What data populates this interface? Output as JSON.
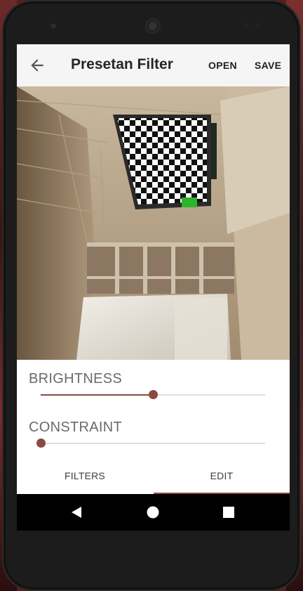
{
  "app_bar": {
    "back_icon": "arrow-back-icon",
    "title": "Presetan Filter",
    "open_label": "OPEN",
    "save_label": "SAVE"
  },
  "image": {
    "description_icon": "photo-preview",
    "accent": "#2bb52b"
  },
  "sliders": [
    {
      "label": "BRIGHTNESS",
      "value": 0.5
    },
    {
      "label": "CONSTRAINT",
      "value": 0.0
    }
  ],
  "tabs": [
    {
      "label": "FILTERS",
      "selected": false
    },
    {
      "label": "EDIT",
      "selected": true
    }
  ],
  "nav_bar": {
    "back_icon": "nav-back-icon",
    "home_icon": "nav-home-icon",
    "recents_icon": "nav-recents-icon"
  },
  "colors": {
    "accent": "#8a4a42",
    "app_bar_bg": "#f5f5f5",
    "nav_bar_bg": "#000000"
  }
}
